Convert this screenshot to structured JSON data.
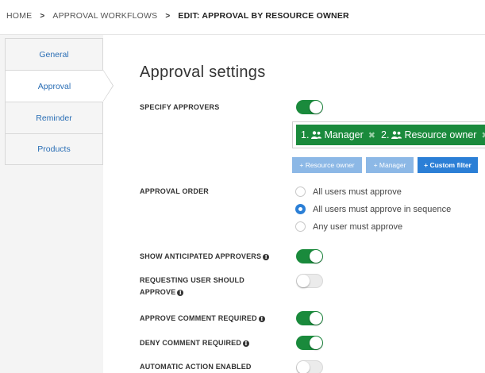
{
  "breadcrumb": {
    "items": [
      "HOME",
      "APPROVAL WORKFLOWS",
      "EDIT: APPROVAL BY RESOURCE OWNER"
    ],
    "separator": ">"
  },
  "tabs": [
    {
      "label": "General",
      "active": false
    },
    {
      "label": "Approval",
      "active": true
    },
    {
      "label": "Reminder",
      "active": false
    },
    {
      "label": "Products",
      "active": false
    }
  ],
  "page_title": "Approval settings",
  "specify_approvers": {
    "label": "SPECIFY APPROVERS",
    "enabled": true,
    "chips": [
      {
        "order": "1.",
        "name": "Manager",
        "icon": "users-icon"
      },
      {
        "order": "2.",
        "name": "Resource owner",
        "icon": "users-icon"
      }
    ],
    "remove_symbol": "✖",
    "buttons": [
      {
        "label": "+ Resource owner",
        "style": "light"
      },
      {
        "label": "+ Manager",
        "style": "light"
      },
      {
        "label": "+ Custom filter",
        "style": "dark"
      }
    ]
  },
  "approval_order": {
    "label": "APPROVAL ORDER",
    "options": [
      {
        "label": "All users must approve",
        "selected": false
      },
      {
        "label": "All users must approve in sequence",
        "selected": true
      },
      {
        "label": "Any user must approve",
        "selected": false
      }
    ]
  },
  "settings": [
    {
      "label": "SHOW ANTICIPATED APPROVERS",
      "info": true,
      "enabled": true
    },
    {
      "label_line1": "REQUESTING USER SHOULD",
      "label_line2": "APPROVE",
      "info": true,
      "enabled": false
    },
    {
      "label": "APPROVE COMMENT REQUIRED",
      "info": true,
      "enabled": true
    },
    {
      "label": "DENY COMMENT REQUIRED",
      "info": true,
      "enabled": true
    },
    {
      "label": "AUTOMATIC ACTION ENABLED",
      "info": false,
      "enabled": false
    }
  ],
  "info_symbol": "i",
  "colors": {
    "accent_green": "#1a8a3c",
    "link_blue": "#2a6eb5",
    "button_light": "#8cb8e6",
    "button_dark": "#2b7fd6"
  }
}
